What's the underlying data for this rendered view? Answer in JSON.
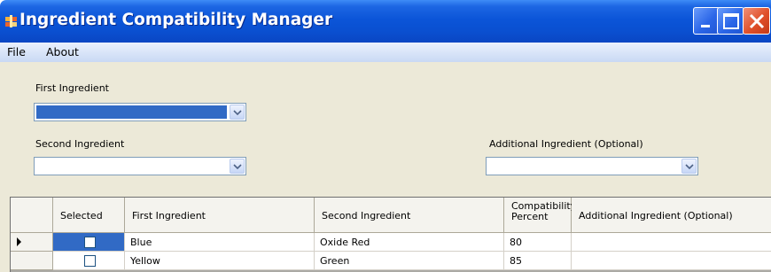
{
  "window": {
    "title": "Ingredient Compatibility Manager"
  },
  "menu": {
    "file": "File",
    "about": "About"
  },
  "form": {
    "first_label": "First Ingredient",
    "first_value": "",
    "second_label": "Second Ingredient",
    "second_value": "",
    "additional_label": "Additional Ingredient (Optional)",
    "additional_value": ""
  },
  "grid": {
    "headers": {
      "selected": "Selected",
      "first": "First Ingredient",
      "second": "Second Ingredient",
      "compat_line1": "Compatibility",
      "compat_line2": "Percent",
      "additional": "Additional Ingredient (Optional)"
    },
    "rows": [
      {
        "selected": false,
        "first": "Blue",
        "second": "Oxide Red",
        "percent": "80",
        "additional": ""
      },
      {
        "selected": false,
        "first": "Yellow",
        "second": "Green",
        "percent": "85",
        "additional": ""
      }
    ]
  },
  "colors": {
    "selection": "#316ac5",
    "form_background": "#ece9d8",
    "titlebar": "#0a4fd0"
  }
}
